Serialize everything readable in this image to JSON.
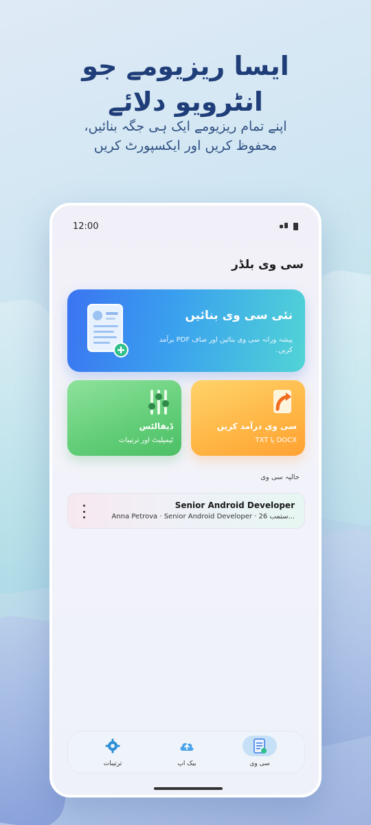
{
  "promo": {
    "headline_line1": "ایسا ریزیومے جو",
    "headline_line2": "انٹرویو دلائے",
    "subline_line1": "اپنے تمام ریزیومے ایک ہی جگہ بنائیں،",
    "subline_line2": "محفوظ کریں اور ایکسپورٹ کریں"
  },
  "status_bar": {
    "time": "12:00"
  },
  "app": {
    "title": "سی وی بلڈر"
  },
  "cards": {
    "new_cv": {
      "title": "نئی سی وی بنائیں",
      "description": "پیشہ ورانہ سی وی بنائیں اور صاف PDF برآمد کریں۔",
      "icon": "document-add-icon"
    },
    "import_cv": {
      "title": "سی وی درآمد کریں",
      "subtitle": "DOCX یا TXT",
      "icon": "import-arrow-icon"
    },
    "defaults": {
      "title": "ڈیفالٹس",
      "subtitle": "ٹیمپلیٹ اور ترتیبات",
      "icon": "sliders-icon"
    }
  },
  "recent": {
    "label": "حالیہ سی وی",
    "items": [
      {
        "title": "Senior Android Developer",
        "subtitle": "Anna Petrova · Senior Android Developer · 26 ستمب..."
      }
    ]
  },
  "bottom_nav": {
    "items": [
      {
        "label": "سی وی",
        "icon": "document-icon",
        "active": true
      },
      {
        "label": "بیک اپ",
        "icon": "cloud-upload-icon",
        "active": false
      },
      {
        "label": "ترتیبات",
        "icon": "gear-icon",
        "active": false
      }
    ]
  },
  "colors": {
    "headline": "#1f3d78",
    "new_card_start": "#3b74f2",
    "new_card_end": "#51d4d6",
    "import_card": "#ffb544",
    "defaults_card": "#62cd78"
  }
}
